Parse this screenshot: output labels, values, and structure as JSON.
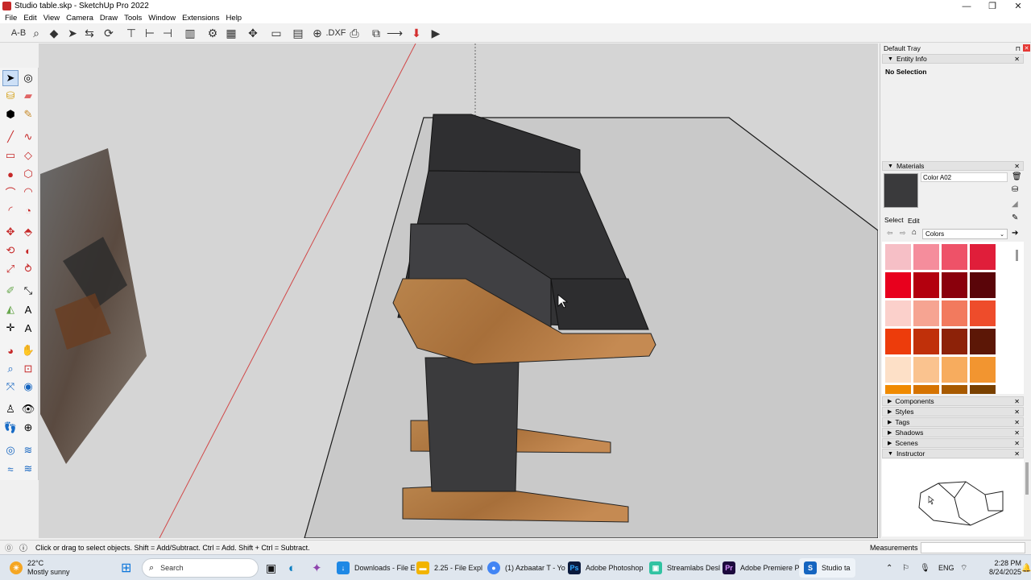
{
  "window": {
    "title": "Studio table.skp - SketchUp Pro 2022",
    "controls": {
      "minimize": "—",
      "restore": "❐",
      "close": "✕"
    }
  },
  "menu": [
    "File",
    "Edit",
    "View",
    "Camera",
    "Draw",
    "Tools",
    "Window",
    "Extensions",
    "Help"
  ],
  "toolbar": {
    "text_icon": "A-B",
    "dxf_label": ".DXF"
  },
  "tray": {
    "title": "Default Tray",
    "entity_info": {
      "header": "Entity Info",
      "value": "No Selection"
    },
    "materials": {
      "header": "Materials",
      "color_name": "Color A02",
      "current_color": "#3a3a3c",
      "tab_select": "Select",
      "tab_edit": "Edit",
      "library": "Colors",
      "swatches": [
        "#f6bfc6",
        "#f58d9c",
        "#ee5268",
        "#e01e3a",
        "#e8001d",
        "#b3000e",
        "#8a000c",
        "#5a0509",
        "#fbd0cb",
        "#f6a492",
        "#f27a5e",
        "#ee4c2b",
        "#ed3c0b",
        "#c0300a",
        "#8d2208",
        "#5c1706",
        "#fde0c7",
        "#fac38f",
        "#f7ac5e",
        "#f29530",
        "#f08a00",
        "#d67300",
        "#a85a00",
        "#7a4100"
      ]
    },
    "collapsed_panels": [
      "Components",
      "Styles",
      "Tags",
      "Shadows",
      "Scenes"
    ],
    "instructor": {
      "header": "Instructor"
    }
  },
  "status": {
    "hint": "Click or drag to select objects. Shift = Add/Subtract. Ctrl = Add. Shift + Ctrl = Subtract.",
    "measurements_label": "Measurements"
  },
  "taskbar": {
    "weather": {
      "temp": "22°C",
      "desc": "Mostly sunny"
    },
    "search_placeholder": "Search",
    "apps": [
      {
        "label": "Downloads - File E",
        "color": "#1e88e5",
        "icon": "download-icon"
      },
      {
        "label": "2.25 - File Expl",
        "color": "#f2b400",
        "icon": "folder-icon"
      },
      {
        "label": "(1) Azbaatar T - Yo",
        "color": "#4285f4",
        "icon": "chrome-icon"
      },
      {
        "label": "Adobe Photoshop",
        "color": "#0a1a3d",
        "icon": "photoshop-icon"
      },
      {
        "label": "Streamlabs Desl",
        "color": "#31c3a2",
        "icon": "streamlabs-icon"
      },
      {
        "label": "Adobe Premiere P",
        "color": "#1c0a3d",
        "icon": "premiere-icon"
      },
      {
        "label": "Studio ta",
        "color": "#1565c0",
        "icon": "sketchup-icon"
      }
    ],
    "lang": "ENG",
    "time": "2:28 PM",
    "date": "8/24/2025"
  }
}
